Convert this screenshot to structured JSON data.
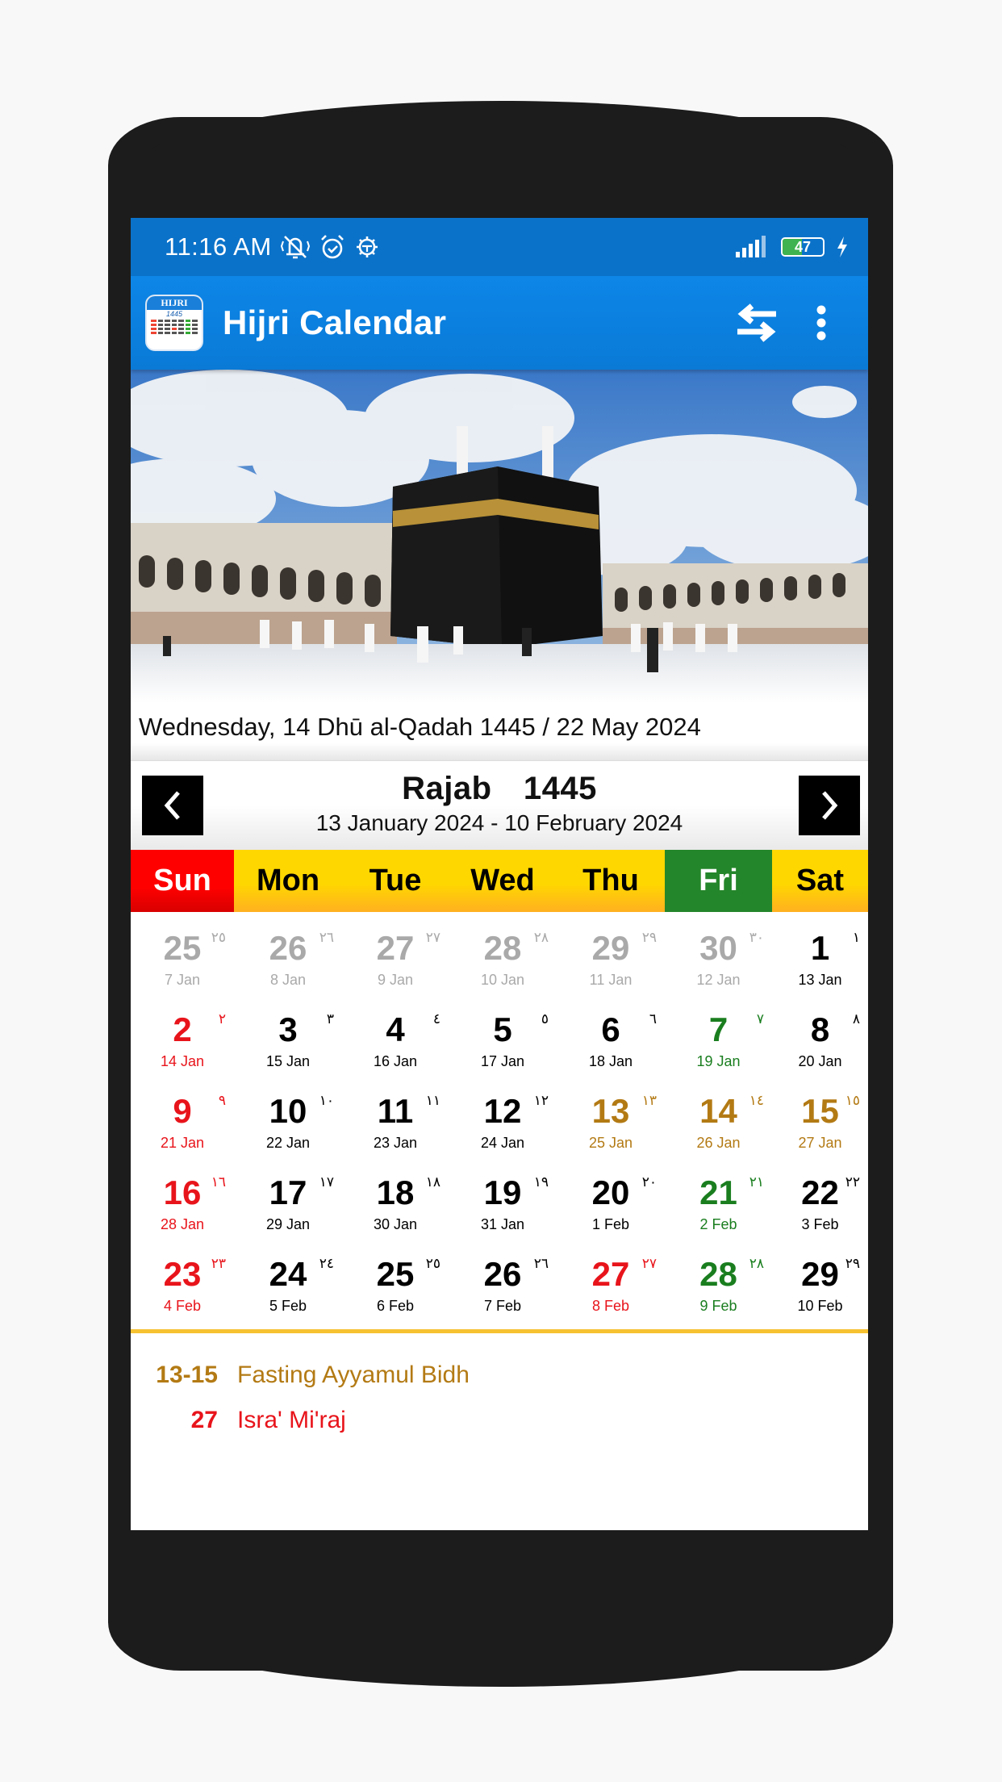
{
  "status_bar": {
    "time": "11:16 AM",
    "left_icons": [
      "vibrate-off-icon",
      "alarm-icon",
      "android-debug-icon"
    ],
    "battery_level": "47",
    "battery_percent": 47,
    "charging": true
  },
  "app_bar": {
    "title": "Hijri Calendar",
    "icon_label": "HIJRI",
    "icon_year": "1445",
    "actions": [
      "swap-icon",
      "more-vert-icon"
    ]
  },
  "today": {
    "text": "Wednesday, 14 Dhū al-Qadah 1445 / 22 May 2024"
  },
  "month_nav": {
    "title": "Rajab  1445",
    "range": "13 January 2024 - 10 February 2024",
    "prev_icon": "chevron-left-icon",
    "next_icon": "chevron-right-icon"
  },
  "weekdays": [
    "Sun",
    "Mon",
    "Tue",
    "Wed",
    "Thu",
    "Fri",
    "Sat"
  ],
  "colors": {
    "status_bar": "#0b72c9",
    "app_bar": "#0d86e8",
    "sunday": "#ff0000",
    "weekday": "#ffd700",
    "friday": "#24862a",
    "gray": "#a9a9a9",
    "red": "#e8141b",
    "green": "#1a7e1f",
    "gold": "#b37a14",
    "divider": "#f6c232"
  },
  "calendar": [
    [
      {
        "h": "25",
        "a": "٢٥",
        "g": "7 Jan",
        "c": "gray"
      },
      {
        "h": "26",
        "a": "٢٦",
        "g": "8 Jan",
        "c": "gray"
      },
      {
        "h": "27",
        "a": "٢٧",
        "g": "9 Jan",
        "c": "gray"
      },
      {
        "h": "28",
        "a": "٢٨",
        "g": "10 Jan",
        "c": "gray"
      },
      {
        "h": "29",
        "a": "٢٩",
        "g": "11 Jan",
        "c": "gray"
      },
      {
        "h": "30",
        "a": "٣٠",
        "g": "12 Jan",
        "c": "gray"
      },
      {
        "h": "1",
        "a": "١",
        "g": "13 Jan",
        "c": "black"
      }
    ],
    [
      {
        "h": "2",
        "a": "٢",
        "g": "14 Jan",
        "c": "red"
      },
      {
        "h": "3",
        "a": "٣",
        "g": "15 Jan",
        "c": "black"
      },
      {
        "h": "4",
        "a": "٤",
        "g": "16 Jan",
        "c": "black"
      },
      {
        "h": "5",
        "a": "٥",
        "g": "17 Jan",
        "c": "black"
      },
      {
        "h": "6",
        "a": "٦",
        "g": "18 Jan",
        "c": "black"
      },
      {
        "h": "7",
        "a": "٧",
        "g": "19 Jan",
        "c": "green"
      },
      {
        "h": "8",
        "a": "٨",
        "g": "20 Jan",
        "c": "black"
      }
    ],
    [
      {
        "h": "9",
        "a": "٩",
        "g": "21 Jan",
        "c": "red"
      },
      {
        "h": "10",
        "a": "١٠",
        "g": "22 Jan",
        "c": "black"
      },
      {
        "h": "11",
        "a": "١١",
        "g": "23 Jan",
        "c": "black"
      },
      {
        "h": "12",
        "a": "١٢",
        "g": "24 Jan",
        "c": "black"
      },
      {
        "h": "13",
        "a": "١٣",
        "g": "25 Jan",
        "c": "gold"
      },
      {
        "h": "14",
        "a": "١٤",
        "g": "26 Jan",
        "c": "gold"
      },
      {
        "h": "15",
        "a": "١٥",
        "g": "27 Jan",
        "c": "gold"
      }
    ],
    [
      {
        "h": "16",
        "a": "١٦",
        "g": "28 Jan",
        "c": "red"
      },
      {
        "h": "17",
        "a": "١٧",
        "g": "29 Jan",
        "c": "black"
      },
      {
        "h": "18",
        "a": "١٨",
        "g": "30 Jan",
        "c": "black"
      },
      {
        "h": "19",
        "a": "١٩",
        "g": "31 Jan",
        "c": "black"
      },
      {
        "h": "20",
        "a": "٢٠",
        "g": "1 Feb",
        "c": "black"
      },
      {
        "h": "21",
        "a": "٢١",
        "g": "2 Feb",
        "c": "green"
      },
      {
        "h": "22",
        "a": "٢٢",
        "g": "3 Feb",
        "c": "black"
      }
    ],
    [
      {
        "h": "23",
        "a": "٢٣",
        "g": "4 Feb",
        "c": "red"
      },
      {
        "h": "24",
        "a": "٢٤",
        "g": "5 Feb",
        "c": "black"
      },
      {
        "h": "25",
        "a": "٢٥",
        "g": "6 Feb",
        "c": "black"
      },
      {
        "h": "26",
        "a": "٢٦",
        "g": "7 Feb",
        "c": "black"
      },
      {
        "h": "27",
        "a": "٢٧",
        "g": "8 Feb",
        "c": "red"
      },
      {
        "h": "28",
        "a": "٢٨",
        "g": "9 Feb",
        "c": "green"
      },
      {
        "h": "29",
        "a": "٢٩",
        "g": "10 Feb",
        "c": "black"
      }
    ]
  ],
  "events": [
    {
      "days": "13-15",
      "name": "Fasting Ayyamul Bidh",
      "c": "gold"
    },
    {
      "days": "27",
      "name": "Isra' Mi'raj",
      "c": "red"
    }
  ],
  "hero_image": "kaaba-photo"
}
